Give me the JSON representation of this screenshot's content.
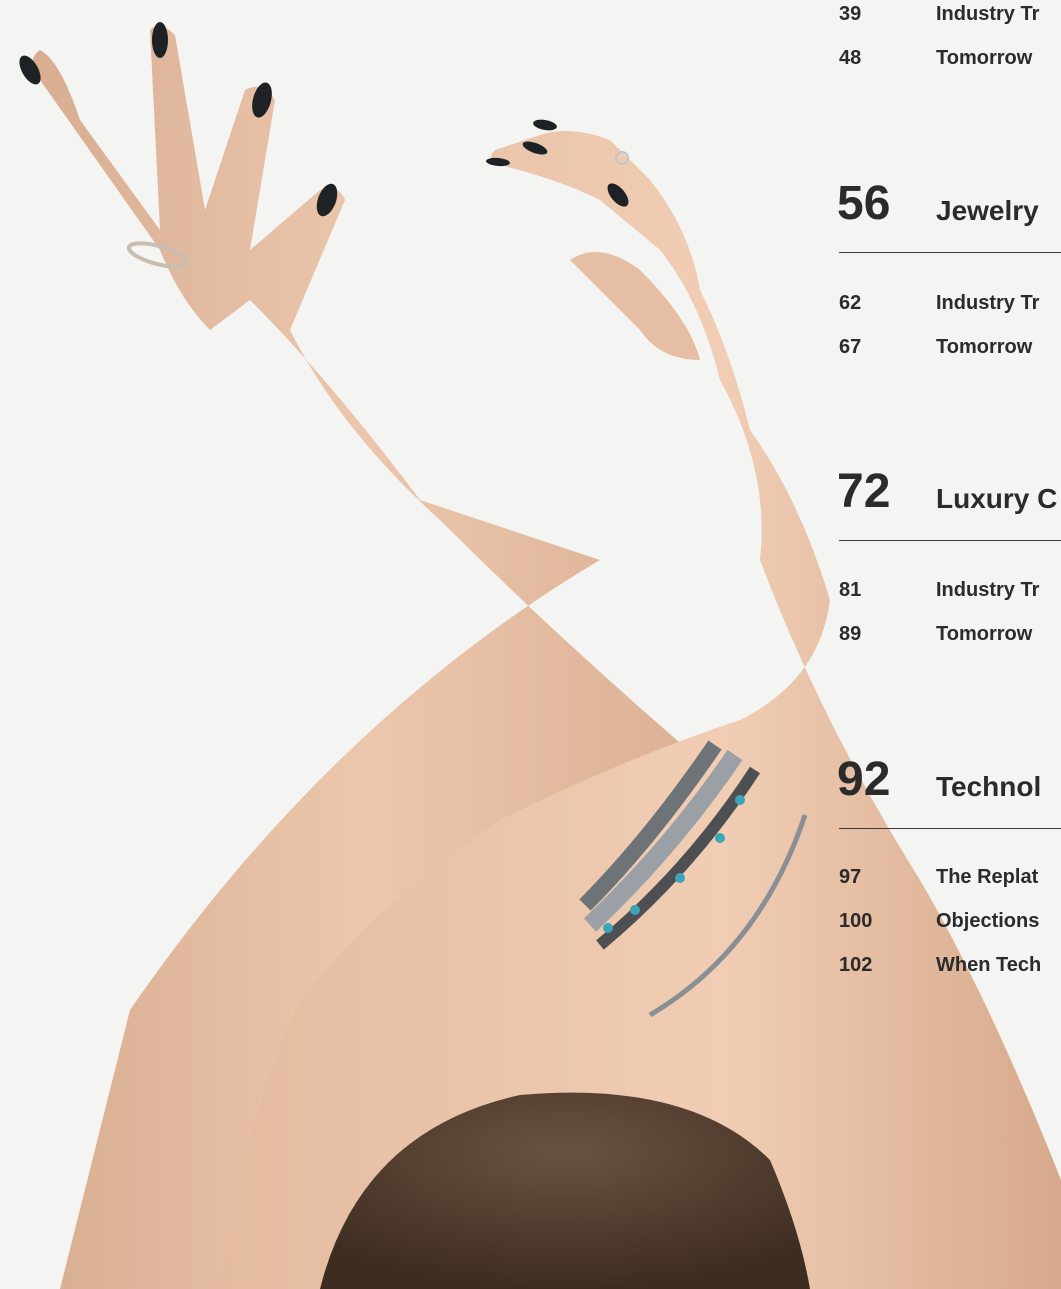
{
  "toc": {
    "top_entries": [
      {
        "page": "39",
        "title": "Industry Tr"
      },
      {
        "page": "48",
        "title": "Tomorrow"
      }
    ],
    "sections": [
      {
        "page": "56",
        "title": "Jewelry",
        "entries": [
          {
            "page": "62",
            "title": "Industry Tr"
          },
          {
            "page": "67",
            "title": "Tomorrow"
          }
        ]
      },
      {
        "page": "72",
        "title": "Luxury C",
        "entries": [
          {
            "page": "81",
            "title": "Industry Tr"
          },
          {
            "page": "89",
            "title": "Tomorrow"
          }
        ]
      },
      {
        "page": "92",
        "title": "Technol",
        "entries": [
          {
            "page": "97",
            "title": "The Replat"
          },
          {
            "page": "100",
            "title": "Objections"
          },
          {
            "page": "102",
            "title": "When Tech"
          }
        ]
      }
    ]
  },
  "photo": {
    "background_color": "#f4f4f3",
    "skin_color": "#e9c3a8",
    "nail_color": "#1f2224",
    "hair_color": "#5a4433",
    "bracelet_color": "#8a8f94",
    "turquoise_color": "#3aa6b8"
  }
}
